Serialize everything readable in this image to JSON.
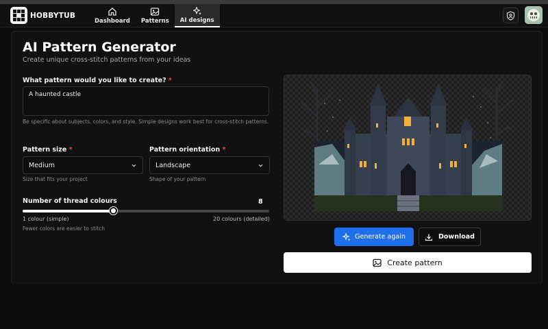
{
  "app": {
    "name": "HOBBYTUB"
  },
  "nav": {
    "items": [
      {
        "label": "Dashboard",
        "icon": "home-icon"
      },
      {
        "label": "Patterns",
        "icon": "image-icon"
      },
      {
        "label": "AI designs",
        "icon": "sparkles-icon",
        "active": true
      }
    ]
  },
  "header": {
    "shield_icon": "shield-user-icon",
    "avatar_icon": "user-avatar"
  },
  "page": {
    "title": "AI Pattern Generator",
    "subtitle": "Create unique cross-stitch patterns from your ideas"
  },
  "form": {
    "prompt": {
      "label": "What pattern would you like to create?",
      "required_mark": "*",
      "value": "A haunted castle",
      "hint": "Be specific about subjects, colors, and style. Simple designs work best for cross-stitch patterns."
    },
    "size": {
      "label": "Pattern size",
      "required_mark": "*",
      "value": "Medium",
      "hint": "Size that fits your project"
    },
    "orientation": {
      "label": "Pattern orientation",
      "required_mark": "*",
      "value": "Landscape",
      "hint": "Shape of your pattern"
    },
    "colours": {
      "label": "Number of thread colours",
      "value": "8",
      "min": 1,
      "max": 20,
      "current": 8,
      "min_label": "1 colour (simple)",
      "max_label": "20 colours (detailed)",
      "hint": "Fewer colors are easier to stitch"
    }
  },
  "actions": {
    "generate_again": "Generate again",
    "download": "Download",
    "create_pattern": "Create pattern"
  },
  "colors": {
    "accent": "#1f6feb",
    "required": "#e5484d",
    "background": "#0b0b0b",
    "window": "#f5b03c"
  }
}
